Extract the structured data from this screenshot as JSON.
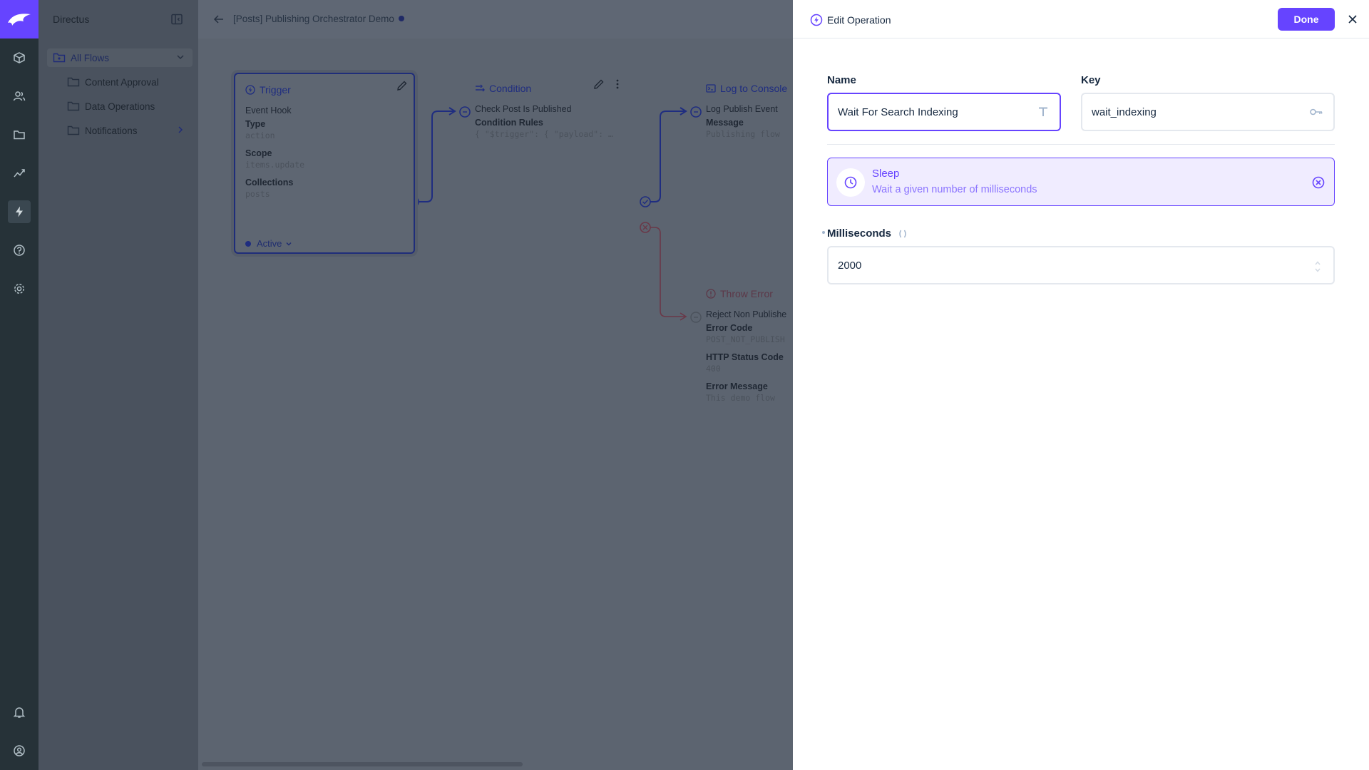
{
  "app": {
    "name": "Directus",
    "colors": {
      "accent": "#6644ff",
      "modulebar": "#263238",
      "overlay": "#5f6774"
    }
  },
  "modules": [
    {
      "name": "content-icon"
    },
    {
      "name": "users-icon"
    },
    {
      "name": "files-icon"
    },
    {
      "name": "insights-icon"
    },
    {
      "name": "flows-icon",
      "active": true
    },
    {
      "name": "help-icon"
    },
    {
      "name": "settings-icon"
    },
    {
      "name": "notifications-icon"
    },
    {
      "name": "account-icon"
    }
  ],
  "nav": {
    "title": "Directus",
    "items": [
      {
        "label": "All Flows"
      },
      {
        "label": "Content Approval"
      },
      {
        "label": "Data Operations"
      },
      {
        "label": "Notifications"
      }
    ]
  },
  "header": {
    "title": "[Posts] Publishing Orchestrator Demo"
  },
  "canvas": {
    "trigger": {
      "title": "Trigger",
      "subtitle": "Event Hook",
      "fields": [
        {
          "label": "Type",
          "value": "action"
        },
        {
          "label": "Scope",
          "value": "items.update"
        },
        {
          "label": "Collections",
          "value": "posts"
        }
      ],
      "status": "Active"
    },
    "condition": {
      "title": "Condition",
      "subtitle": "Check Post Is Published",
      "fields": [
        {
          "label": "Condition Rules",
          "value": "{ \"$trigger\": { \"payload\": …"
        }
      ]
    },
    "log": {
      "title": "Log to Console",
      "subtitle": "Log Publish Event",
      "fields": [
        {
          "label": "Message",
          "value": "Publishing flow"
        }
      ]
    },
    "throw": {
      "title": "Throw Error",
      "subtitle": "Reject Non Publishe",
      "fields": [
        {
          "label": "Error Code",
          "value": "POST_NOT_PUBLISH"
        },
        {
          "label": "HTTP Status Code",
          "value": "400"
        },
        {
          "label": "Error Message",
          "value": "This demo flow"
        }
      ]
    }
  },
  "drawer": {
    "title": "Edit Operation",
    "done_label": "Done",
    "name": {
      "label": "Name",
      "value": "Wait For Search Indexing"
    },
    "key": {
      "label": "Key",
      "value": "wait_indexing"
    },
    "operation": {
      "name": "Sleep",
      "description": "Wait a given number of milliseconds"
    },
    "milliseconds": {
      "label": "Milliseconds",
      "value": "2000"
    }
  }
}
